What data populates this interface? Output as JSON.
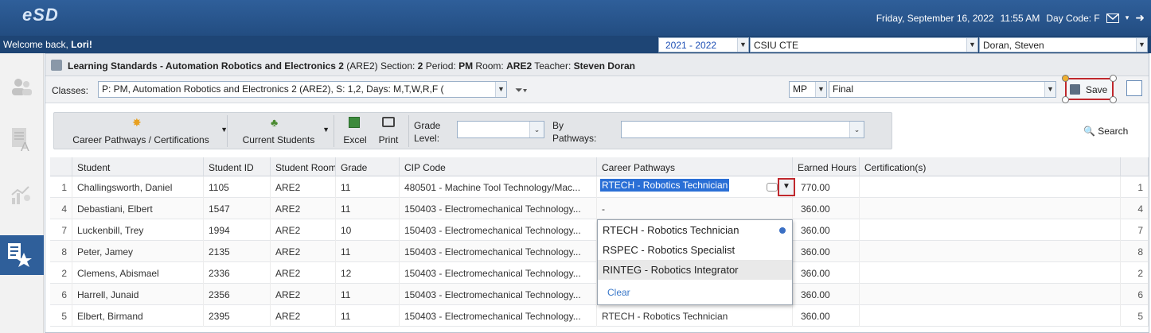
{
  "header": {
    "logo": "eSD",
    "date": "Friday, September 16, 2022",
    "time": "11:55 AM",
    "day_code": "Day Code: F",
    "welcome_prefix": "Welcome back, ",
    "welcome_name": "Lori!",
    "year_select": "2021 - 2022",
    "school_select": "CSIU CTE",
    "teacher_select": "Doran, Steven"
  },
  "title": {
    "prefix": "Learning Standards - Automation Robotics and Electronics 2",
    "code": "(ARE2)",
    "section_label": "Section:",
    "section": "2",
    "period_label": "Period:",
    "period": "PM",
    "room_label": "Room:",
    "room": "ARE2",
    "teacher_label": "Teacher:",
    "teacher": "Steven Doran"
  },
  "classbar": {
    "classes_label": "Classes:",
    "class_value": "P: PM, Automation Robotics and Electronics  2 (ARE2), S: 1,2, Days: M,T,W,R,F (",
    "mp_label": "MP",
    "mp_value": "Final",
    "save_label": "Save"
  },
  "toolbar": {
    "career_label": "Career Pathways / Certifications",
    "students_label": "Current Students",
    "excel_label": "Excel",
    "print_label": "Print",
    "grade_label_1": "Grade",
    "grade_label_2": "Level:",
    "pathways_label_1": "By",
    "pathways_label_2": "Pathways:",
    "search_label": "Search"
  },
  "table": {
    "columns": [
      "Student",
      "Student ID",
      "Student Room",
      "Grade",
      "CIP Code",
      "Career Pathways",
      "Earned Hours",
      "Certification(s)"
    ],
    "rows": [
      {
        "n": "1",
        "student": "Challingsworth, Daniel",
        "id": "1105",
        "room": "ARE2",
        "grade": "11",
        "cip": "480501 - Machine Tool Technology/Mac...",
        "path": "RTECH - Robotics Technician",
        "hours": "770.00",
        "cert": "",
        "rn": "1"
      },
      {
        "n": "4",
        "student": "Debastiani, Elbert",
        "id": "1547",
        "room": "ARE2",
        "grade": "11",
        "cip": "150403 - Electromechanical Technology...",
        "path": "-",
        "hours": "360.00",
        "cert": "",
        "rn": "4"
      },
      {
        "n": "7",
        "student": "Luckenbill, Trey",
        "id": "1994",
        "room": "ARE2",
        "grade": "10",
        "cip": "150403 - Electromechanical Technology...",
        "path": "",
        "hours": "360.00",
        "cert": "",
        "rn": "7"
      },
      {
        "n": "8",
        "student": "Peter, Jamey",
        "id": "2135",
        "room": "ARE2",
        "grade": "11",
        "cip": "150403 - Electromechanical Technology...",
        "path": "",
        "hours": "360.00",
        "cert": "",
        "rn": "8"
      },
      {
        "n": "2",
        "student": "Clemens, Abismael",
        "id": "2336",
        "room": "ARE2",
        "grade": "12",
        "cip": "150403 - Electromechanical Technology...",
        "path": "",
        "hours": "360.00",
        "cert": "",
        "rn": "2"
      },
      {
        "n": "6",
        "student": "Harrell, Junaid",
        "id": "2356",
        "room": "ARE2",
        "grade": "11",
        "cip": "150403 - Electromechanical Technology...",
        "path": "",
        "hours": "360.00",
        "cert": "",
        "rn": "6"
      },
      {
        "n": "5",
        "student": "Elbert, Birmand",
        "id": "2395",
        "room": "ARE2",
        "grade": "11",
        "cip": "150403 - Electromechanical Technology...",
        "path": "RTECH - Robotics Technician",
        "hours": "360.00",
        "cert": "",
        "rn": "5"
      }
    ]
  },
  "dropdown": {
    "options": [
      "RTECH - Robotics Technician",
      "RSPEC - Robotics Specialist",
      "RINTEG - Robotics Integrator"
    ],
    "clear_label": "Clear"
  },
  "colors": {
    "header_blue": "#2f5f9a",
    "highlight_red": "#c0282d",
    "selected_blue": "#2a6fd6"
  }
}
